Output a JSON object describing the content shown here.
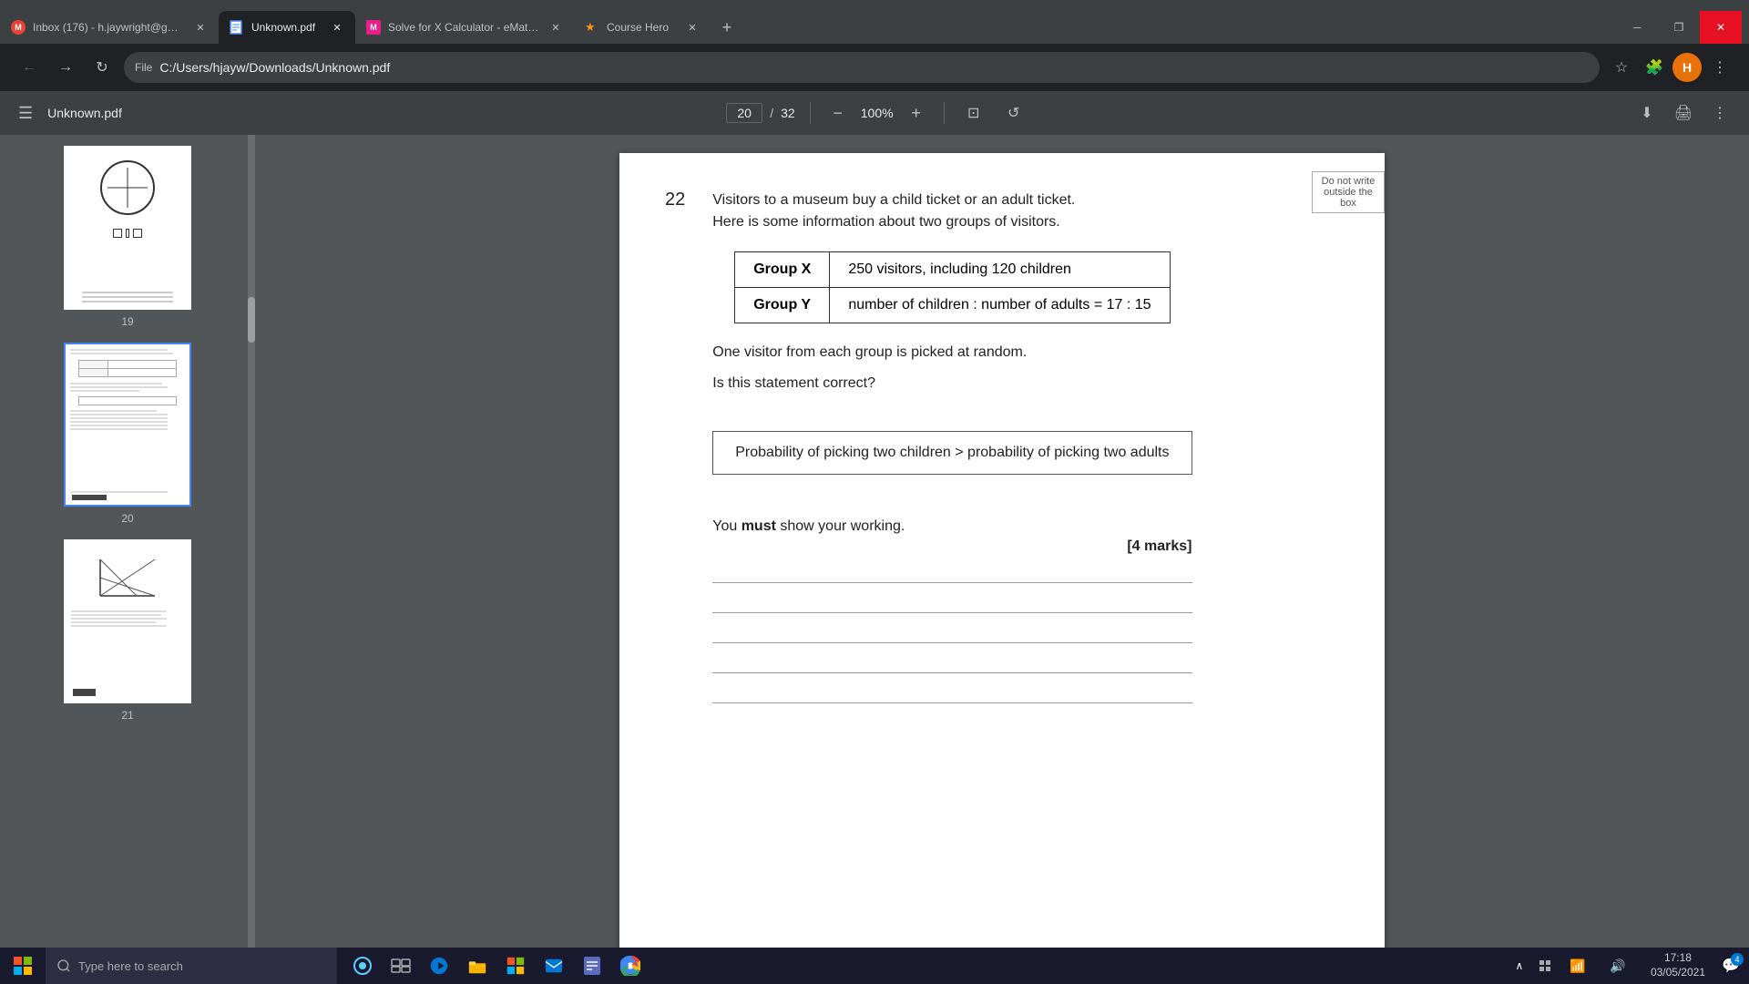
{
  "tabs": [
    {
      "id": "gmail",
      "title": "Inbox (176) - h.jaywright@gmail...",
      "favicon": "G",
      "favicon_color": "#ea4335",
      "active": false,
      "closeable": true
    },
    {
      "id": "pdf",
      "title": "Unknown.pdf",
      "favicon": "📄",
      "favicon_color": "#4285f4",
      "active": true,
      "closeable": true
    },
    {
      "id": "emathhelp",
      "title": "Solve for X Calculator - eMathHe...",
      "favicon": "M",
      "favicon_color": "#e91e8c",
      "active": false,
      "closeable": true
    },
    {
      "id": "coursehero",
      "title": "Course Hero",
      "favicon": "★",
      "favicon_color": "#f7931e",
      "active": false,
      "closeable": true
    }
  ],
  "address_bar": {
    "protocol": "File",
    "url": "C:/Users/hjayw/Downloads/Unknown.pdf"
  },
  "pdf_toolbar": {
    "title": "Unknown.pdf",
    "current_page": "20",
    "total_pages": "32",
    "zoom": "100%"
  },
  "pdf_content": {
    "question_number": "22",
    "intro_line1": "Visitors to a museum buy a child ticket or an adult ticket.",
    "intro_line2": "Here is some information about two groups of visitors.",
    "table_rows": [
      {
        "group": "Group X",
        "info": "250 visitors, including 120 children"
      },
      {
        "group": "Group Y",
        "info": "number of children : number of adults = 17 : 15"
      }
    ],
    "body_text1": "One visitor from each group is picked at random.",
    "body_text2": "Is this statement correct?",
    "statement": "Probability of picking two children > probability of picking two adults",
    "must_text_prefix": "You ",
    "must_text_bold": "must",
    "must_text_suffix": " show your working.",
    "marks": "[4 marks]",
    "donotwrite_line1": "Do not write",
    "donotwrite_line2": "outside the",
    "donotwrite_line3": "box"
  },
  "thumbnails": [
    {
      "num": "19",
      "active": false
    },
    {
      "num": "20",
      "active": true
    },
    {
      "num": "21",
      "active": false
    }
  ],
  "taskbar": {
    "search_placeholder": "Type here to search",
    "time": "17:18",
    "date": "03/05/2021",
    "notification_count": "4"
  }
}
